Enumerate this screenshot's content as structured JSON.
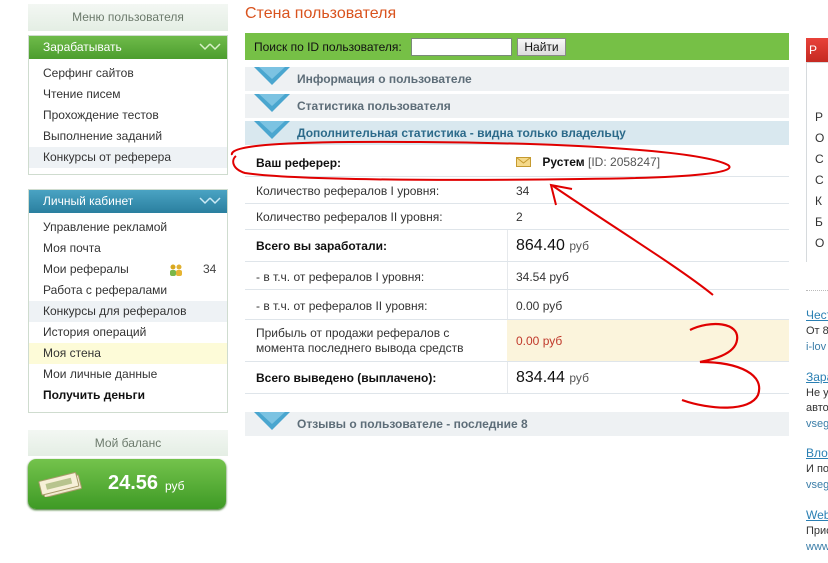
{
  "sidebar": {
    "title": "Меню пользователя",
    "earn": {
      "header": "Зарабатывать",
      "items": [
        "Серфинг сайтов",
        "Чтение писем",
        "Прохождение тестов",
        "Выполнение заданий",
        "Конкурсы от реферера"
      ]
    },
    "cabinet": {
      "header": "Личный кабинет",
      "items": [
        "Управление рекламой",
        "Моя почта",
        "Мои рефералы",
        "Работа с рефералами",
        "Конкурсы для рефералов",
        "История операций",
        "Моя стена",
        "Мои личные данные",
        "Получить деньги"
      ],
      "referrals_count": "34"
    },
    "balance": {
      "title": "Мой баланс",
      "amount": "24.56",
      "currency": "руб"
    }
  },
  "main": {
    "title": "Стена пользователя",
    "search": {
      "label": "Поиск по ID пользователя:",
      "value": "",
      "button": "Найти"
    },
    "sections": [
      "Информация о пользователе",
      "Статистика пользователя",
      "Дополнительная статистика - видна только владельцу",
      "Отзывы о пользователе - последние 8"
    ],
    "stats": {
      "referer_label": "Ваш реферер:",
      "referer_name": "Рустем",
      "referer_id": "[ID: 2058247]",
      "ref1_label": "Количество рефералов I уровня:",
      "ref1_value": "34",
      "ref2_label": "Количество рефералов II уровня:",
      "ref2_value": "2",
      "earned_label": "Всего вы заработали:",
      "earned_value": "864.40",
      "from_ref1_label": "- в т.ч. от рефералов I уровня:",
      "from_ref1_value": "34.54",
      "from_ref2_label": "- в т.ч. от рефералов II уровня:",
      "from_ref2_value": "0.00",
      "sales_label_1": "Прибыль от продажи рефералов с",
      "sales_label_2": "момента последнего вывода средств",
      "sales_value": "0.00",
      "withdrawn_label": "Всего выведено (выплачено):",
      "withdrawn_value": "834.44",
      "currency": "руб"
    }
  },
  "annotation": {
    "number": "3",
    "color": "#e00000"
  },
  "right_column": {
    "header": "Р",
    "letters": [
      "Р",
      "О",
      "С",
      "С",
      "К",
      "Б",
      "О"
    ],
    "news": [
      {
        "title": "Чест",
        "text": "От 8",
        "sub": "i-lov"
      },
      {
        "title": "Зара",
        "text": "Не у",
        "text2": "авто",
        "sub": "vseg"
      },
      {
        "title": "Влоэ",
        "text": "И по",
        "sub": "vseg"
      },
      {
        "title": "Web",
        "text": "Прис",
        "sub": "www"
      }
    ]
  },
  "colors": {
    "accent_orange": "#d9531e",
    "search_green": "#76c046",
    "earn_green": "#5aab38",
    "cabinet_teal": "#3a93b3"
  }
}
